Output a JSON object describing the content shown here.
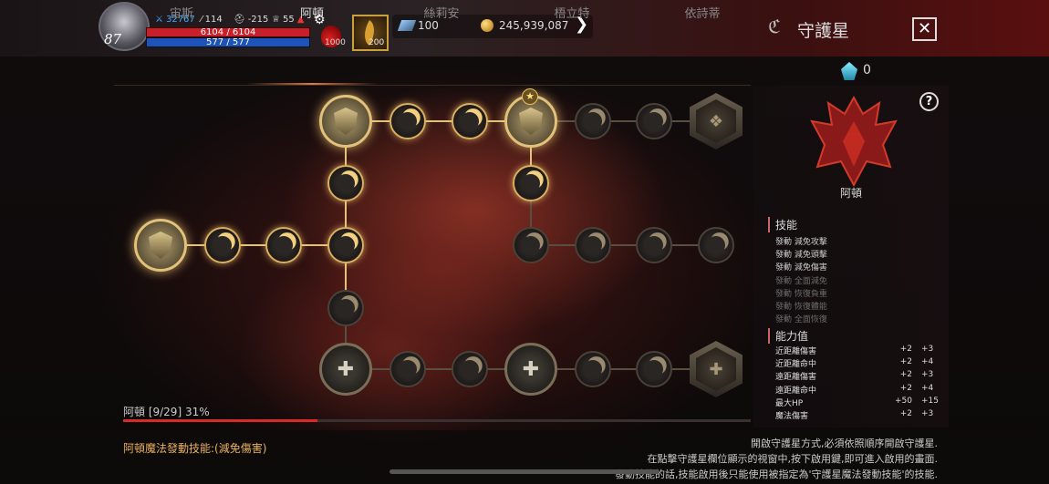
{
  "player": {
    "level": "87",
    "combat_power": "32767",
    "stat_attack": "114",
    "stat_defense": "-215",
    "stat_trophy": "55",
    "hp": "6104 / 6104",
    "mp": "577 / 577",
    "potion_count": "1000",
    "quick_item_count": "200"
  },
  "currency": {
    "crystal": "100",
    "gold": "245,939,087"
  },
  "window": {
    "title": "守護星",
    "close": "✕"
  },
  "tabs": [
    "宙斯",
    "阿頓",
    "絲莉安",
    "梧立特",
    "依詩蒂"
  ],
  "active_tab": 1,
  "gem_count": "0",
  "help": "?",
  "panel": {
    "name": "阿頓",
    "skills_header": "技能",
    "skills": [
      {
        "label": "發動 減免攻擊",
        "active": true
      },
      {
        "label": "發動 減免頭擊",
        "active": true
      },
      {
        "label": "發動 減免傷害",
        "active": true
      },
      {
        "label": "發動 全面減免",
        "active": false
      },
      {
        "label": "發動 恢復負重",
        "active": false
      },
      {
        "label": "發動 恢復體能",
        "active": false
      },
      {
        "label": "發動 全面恢復",
        "active": false
      }
    ],
    "stats_header": "能力值",
    "stats": [
      {
        "label": "近距離傷害",
        "a": "+2",
        "b": "+3"
      },
      {
        "label": "近距離命中",
        "a": "+2",
        "b": "+4"
      },
      {
        "label": "遠距離傷害",
        "a": "+2",
        "b": "+3"
      },
      {
        "label": "遠距離命中",
        "a": "+2",
        "b": "+4"
      },
      {
        "label": "最大HP",
        "a": "+50",
        "b": "+15"
      },
      {
        "label": "魔法傷害",
        "a": "+2",
        "b": "+3"
      }
    ]
  },
  "progress": {
    "label": "阿頓 [9/29] 31%",
    "fraction": 0.31
  },
  "footer": {
    "magic_skill": "阿頓魔法發動技能:(減免傷害)",
    "notes": [
      "開啟守護星方式,必須依照順序開啟守護星.",
      "在點擊守護星欄位顯示的視窗中,按下啟用鍵,即可進入啟用的畫面.",
      "發動技能的話,技能啟用後只能使用被指定為'守護星魔法發動技能'的技能."
    ]
  },
  "icons": {
    "close": "close-icon",
    "help": "question-icon",
    "gem": "crystal-icon",
    "gold": "coin-icon",
    "arrow": "chevron-right-icon"
  }
}
